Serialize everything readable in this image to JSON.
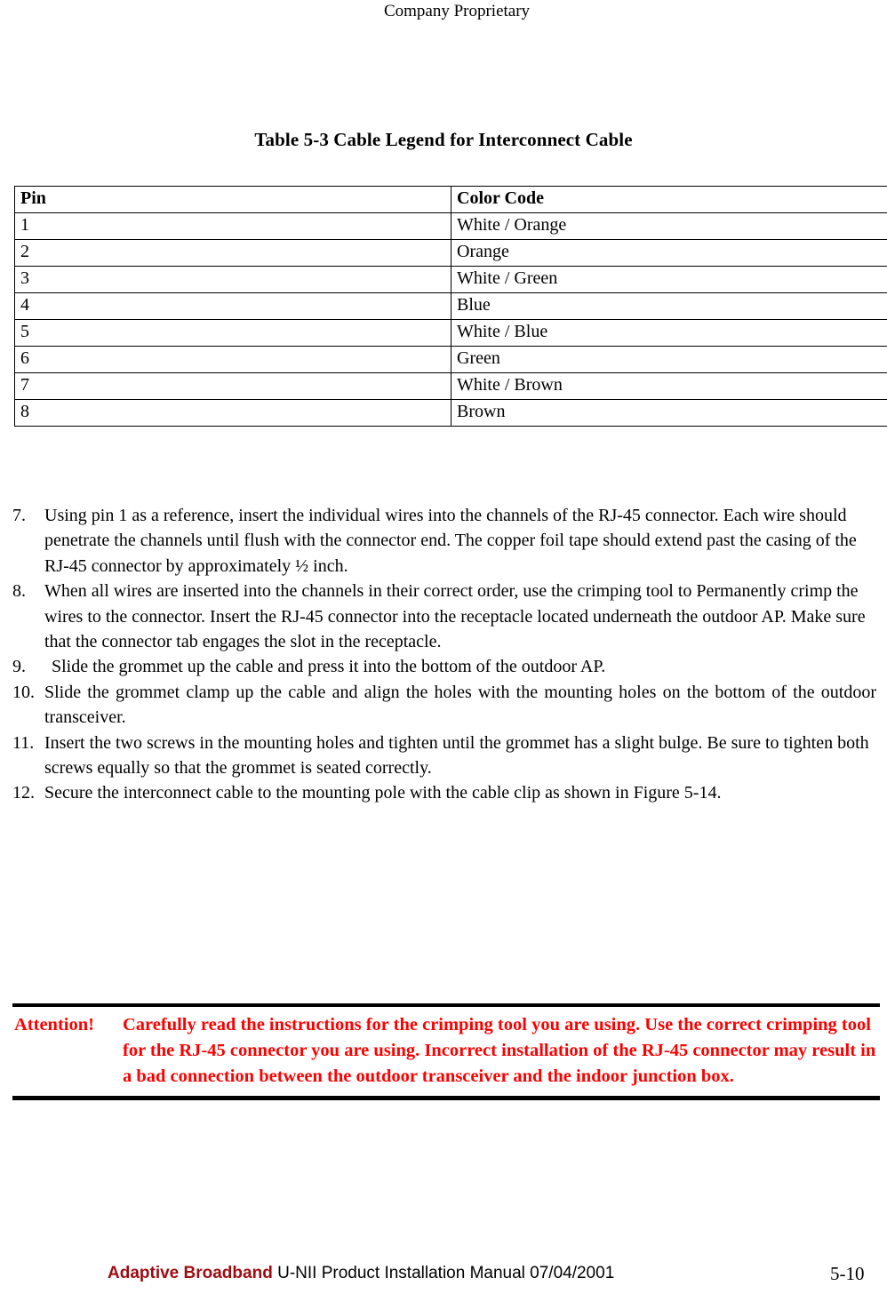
{
  "header": {
    "text": "Company Proprietary"
  },
  "table": {
    "caption": "Table 5-3  Cable Legend for Interconnect Cable",
    "columns": [
      "Pin",
      "Color Code"
    ],
    "rows": [
      {
        "pin": "1",
        "color": "White / Orange"
      },
      {
        "pin": "2",
        "color": "Orange"
      },
      {
        "pin": "3",
        "color": "White / Green"
      },
      {
        "pin": "4",
        "color": "Blue"
      },
      {
        "pin": "5",
        "color": "White / Blue"
      },
      {
        "pin": "6",
        "color": "Green"
      },
      {
        "pin": "7",
        "color": "White / Brown"
      },
      {
        "pin": "8",
        "color": "Brown"
      }
    ]
  },
  "steps": [
    {
      "num": "7.",
      "text": "Using pin 1 as a reference, insert the individual wires into the channels of the RJ-45 connector.  Each wire should penetrate the channels until flush with the connector end.  The copper foil tape should extend past the casing of the RJ-45 connector by approximately ½ inch."
    },
    {
      "num": "8.",
      "text": "When all wires are inserted into the channels in their correct order, use the crimping tool to Permanently crimp the wires to the connector. Insert the RJ-45 connector into the receptacle located underneath the outdoor AP.  Make sure that the connector tab engages the slot in the receptacle."
    },
    {
      "num": "9.",
      "text": "Slide the grommet up the cable and press it into the bottom of the outdoor AP."
    },
    {
      "num": "10.",
      "text": "Slide the grommet clamp up the cable and align the holes with the mounting holes on the bottom of the outdoor transceiver."
    },
    {
      "num": "11.",
      "text": "Insert the two screws in the mounting holes and tighten until the grommet has a slight bulge.  Be sure to tighten both screws equally so that the grommet is seated correctly."
    },
    {
      "num": "12.",
      "text": "Secure the interconnect cable to the mounting pole with the cable clip as shown in Figure 5-14."
    }
  ],
  "attention": {
    "label": "Attention!",
    "text": "Carefully read the instructions for the crimping tool you are using.  Use the correct crimping tool for the RJ-45 connector you are using.  Incorrect installation of the RJ-45 connector may result in a bad connection between the outdoor transceiver and the indoor junction box.",
    "color": "#ff0000"
  },
  "footer": {
    "brand": "Adaptive Broadband",
    "manual": "U-NII Product Installation Manual  07/04/2001",
    "page": "5-10",
    "brand_color": "#9e0b11"
  }
}
